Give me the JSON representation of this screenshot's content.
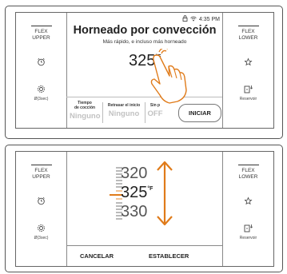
{
  "colors": {
    "accent": "#e07b1a",
    "muted": "#c2c2c2",
    "border": "#666666"
  },
  "screen1": {
    "left_panel": {
      "flex_label": "FLEX\nUPPER",
      "timer_icon": "alarm-clock-icon",
      "settings_icon": "gear-icon",
      "settings_hint": "Ø(3sec)"
    },
    "right_panel": {
      "flex_label": "FLEX\nLOWER",
      "light_icon": "light-bulb-icon",
      "reservoir_icon": "reservoir-icon",
      "reservoir_label": "Reservoir"
    },
    "status": {
      "lock_icon": "lock-icon",
      "wifi_icon": "wifi-icon",
      "time": "4:35 PM"
    },
    "title": "Horneado por convección",
    "subtitle": "Más rápido, e incluso más horneado",
    "temperature": "325",
    "temp_unit": "°F",
    "options": [
      {
        "label": "Tiempo\nde cocción",
        "value": "Ninguno"
      },
      {
        "label": "Retrasar el inicio",
        "value": "Ninguno"
      },
      {
        "label": "Sin p",
        "value": "OFF"
      }
    ],
    "start_button": "INICIAR"
  },
  "screen2": {
    "left_panel": {
      "flex_label": "FLEX\nUPPER",
      "timer_icon": "alarm-clock-icon",
      "settings_icon": "gear-icon",
      "settings_hint": "Ø(3sec)"
    },
    "right_panel": {
      "flex_label": "FLEX\nLOWER",
      "light_icon": "light-bulb-icon",
      "reservoir_icon": "reservoir-icon",
      "reservoir_label": "Reservoir"
    },
    "scroll_values": {
      "above": "320",
      "selected": "325",
      "below": "330",
      "unit": "°F"
    },
    "cancel_button": "CANCELAR",
    "set_button": "ESTABLECER"
  }
}
